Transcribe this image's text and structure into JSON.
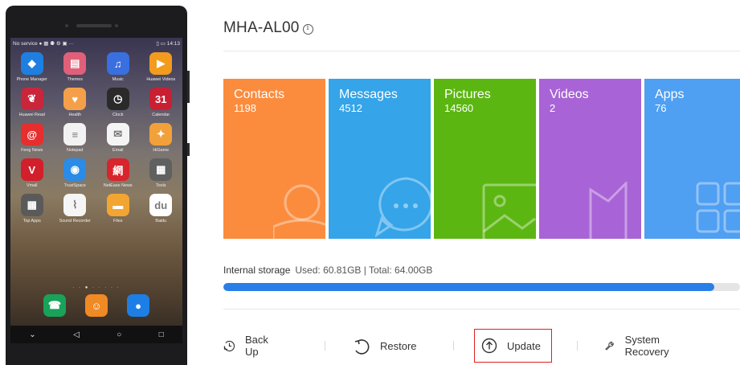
{
  "device": {
    "title": "MHA-AL00"
  },
  "phone": {
    "status_left": "No service ● ▦ ⚉ ⚙ ▣ ···",
    "status_right": "▯ ▭ 14:13",
    "apps": [
      {
        "label": "Phone Manager",
        "icon": "shield-icon",
        "color": "#1e7fe0",
        "glyph": "◆"
      },
      {
        "label": "Themes",
        "icon": "themes-icon",
        "color": "#e0607a",
        "glyph": "▤"
      },
      {
        "label": "Music",
        "icon": "music-icon",
        "color": "#3a6fe0",
        "glyph": "♫"
      },
      {
        "label": "Huawei Videos",
        "icon": "play-icon",
        "color": "#f29b1d",
        "glyph": "▶"
      },
      {
        "label": "Huawei Read",
        "icon": "book-icon",
        "color": "#c9263b",
        "glyph": "❦"
      },
      {
        "label": "Health",
        "icon": "heart-icon",
        "color": "#f4a04a",
        "glyph": "♥"
      },
      {
        "label": "Clock",
        "icon": "clock-icon",
        "color": "#2a2a2a",
        "glyph": "◷"
      },
      {
        "label": "Calendar",
        "icon": "calendar-icon",
        "color": "#c81f33",
        "glyph": "31"
      },
      {
        "label": "Feng News",
        "icon": "news-icon",
        "color": "#e62e2e",
        "glyph": "@"
      },
      {
        "label": "Notepad",
        "icon": "notepad-icon",
        "color": "#f2f2f2",
        "glyph": "≡"
      },
      {
        "label": "Email",
        "icon": "mail-icon",
        "color": "#f4f4f4",
        "glyph": "✉"
      },
      {
        "label": "HiGame",
        "icon": "gamepad-icon",
        "color": "#f2a13a",
        "glyph": "✦"
      },
      {
        "label": "Vmall",
        "icon": "vmall-icon",
        "color": "#d11f2c",
        "glyph": "V"
      },
      {
        "label": "TrustSpace",
        "icon": "trust-icon",
        "color": "#2b8be6",
        "glyph": "◉"
      },
      {
        "label": "NetEase News",
        "icon": "netease-icon",
        "color": "#d8242c",
        "glyph": "網"
      },
      {
        "label": "Tools",
        "icon": "tools-icon",
        "color": "#606060",
        "glyph": "▦"
      },
      {
        "label": "Top Apps",
        "icon": "topapps-icon",
        "color": "#5a5a5a",
        "glyph": "▦"
      },
      {
        "label": "Sound Recorder",
        "icon": "recorder-icon",
        "color": "#f5f5f5",
        "glyph": "⌇"
      },
      {
        "label": "Files",
        "icon": "folder-icon",
        "color": "#f3a531",
        "glyph": "▬"
      },
      {
        "label": "Baidu",
        "icon": "baidu-icon",
        "color": "#ffffff",
        "glyph": "du"
      }
    ],
    "page_dots": "· · ● · · · · ·",
    "dock": [
      {
        "icon": "phone-icon",
        "color": "#19a25a",
        "glyph": "☎"
      },
      {
        "icon": "contacts-icon",
        "color": "#f08a24",
        "glyph": "☺"
      },
      {
        "icon": "message-icon",
        "color": "#1d7ee6",
        "glyph": "●"
      }
    ],
    "nav": {
      "down": "⌄",
      "back": "◁",
      "home": "○",
      "recent": "□"
    }
  },
  "tiles": [
    {
      "name": "Contacts",
      "count": "1198",
      "color": "#fb8c3e",
      "icon": "contacts-icon"
    },
    {
      "name": "Messages",
      "count": "4512",
      "color": "#35a4e9",
      "icon": "messages-icon"
    },
    {
      "name": "Pictures",
      "count": "14560",
      "color": "#5cb612",
      "icon": "pictures-icon"
    },
    {
      "name": "Videos",
      "count": "2",
      "color": "#a864d6",
      "icon": "videos-icon"
    },
    {
      "name": "Apps",
      "count": "76",
      "color": "#4f9ff2",
      "icon": "apps-icon"
    }
  ],
  "storage": {
    "label": "Internal storage",
    "detail": "Used: 60.81GB | Total: 64.00GB",
    "used_fraction": 0.95
  },
  "actions": [
    {
      "label": "Back Up",
      "icon": "clock-backup-icon"
    },
    {
      "label": "Restore",
      "icon": "restore-icon"
    },
    {
      "label": "Update",
      "icon": "upload-icon",
      "highlighted": true
    },
    {
      "label": "System Recovery",
      "icon": "wrench-icon"
    }
  ]
}
